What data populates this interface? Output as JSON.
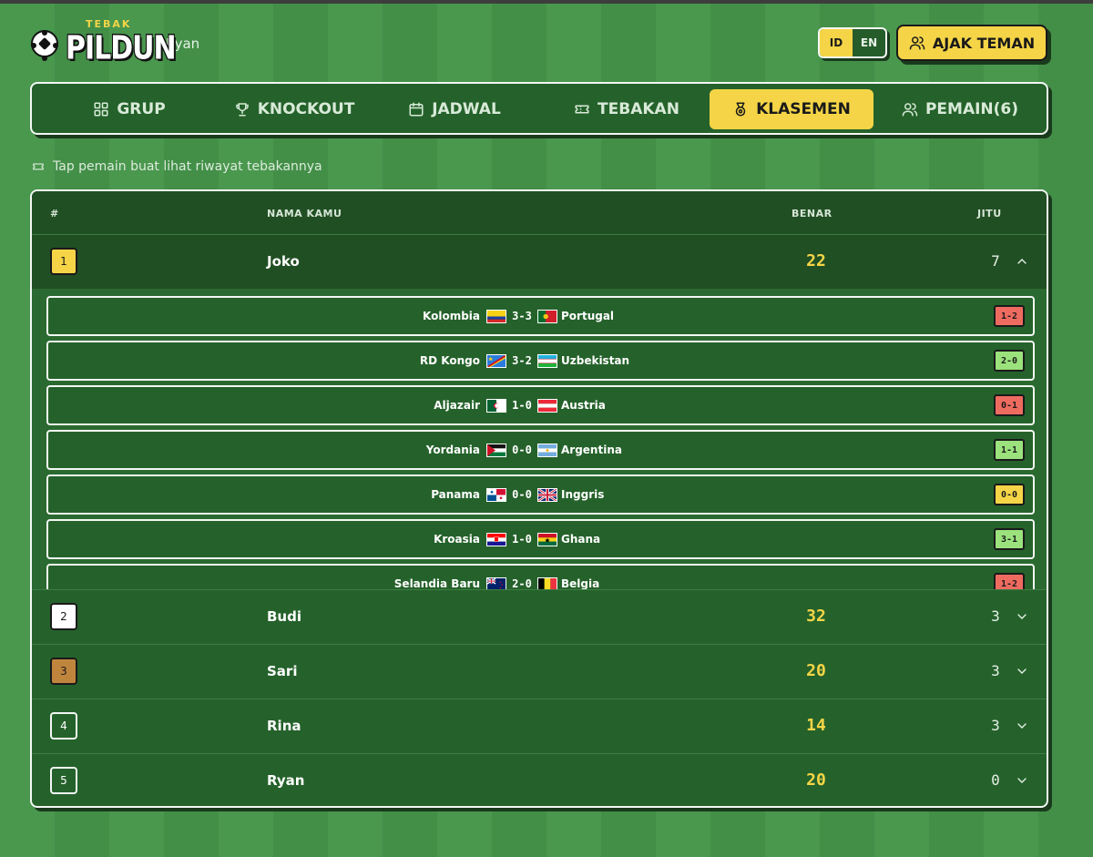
{
  "app": {
    "logo_small": "TEBAK",
    "logo_big": "PILDUN",
    "user": "Ryan"
  },
  "lang": {
    "id": "ID",
    "en": "EN",
    "active": "ID"
  },
  "invite_label": "AJAK TEMAN",
  "nav": [
    {
      "label": "GRUP",
      "icon": "grid-icon"
    },
    {
      "label": "KNOCKOUT",
      "icon": "trophy-icon"
    },
    {
      "label": "JADWAL",
      "icon": "calendar-icon"
    },
    {
      "label": "TEBAKAN",
      "icon": "ticket-icon"
    },
    {
      "label": "KLASEMEN",
      "icon": "medal-icon",
      "active": true
    },
    {
      "label": "PEMAIN(6)",
      "icon": "users-icon"
    }
  ],
  "hint": "Tap pemain buat lihat riwayat tebakannya",
  "table": {
    "headers": {
      "rank": "#",
      "name": "NAMA KAMU",
      "benar": "BENAR",
      "jitu": "JITU"
    },
    "rows": [
      {
        "rank": "1",
        "name": "Joko",
        "benar": "22",
        "jitu": "7",
        "expanded": true
      },
      {
        "rank": "2",
        "name": "Budi",
        "benar": "32",
        "jitu": "3"
      },
      {
        "rank": "3",
        "name": "Sari",
        "benar": "20",
        "jitu": "3"
      },
      {
        "rank": "4",
        "name": "Rina",
        "benar": "14",
        "jitu": "3"
      },
      {
        "rank": "5",
        "name": "Ryan",
        "benar": "20",
        "jitu": "0"
      }
    ]
  },
  "matches": [
    {
      "home": "Kolombia",
      "score": "3-3",
      "away": "Portugal",
      "pred": "1-2",
      "status": "wrong"
    },
    {
      "home": "RD Kongo",
      "score": "3-2",
      "away": "Uzbekistan",
      "pred": "2-0",
      "status": "right"
    },
    {
      "home": "Aljazair",
      "score": "1-0",
      "away": "Austria",
      "pred": "0-1",
      "status": "wrong"
    },
    {
      "home": "Yordania",
      "score": "0-0",
      "away": "Argentina",
      "pred": "1-1",
      "status": "right"
    },
    {
      "home": "Panama",
      "score": "0-0",
      "away": "Inggris",
      "pred": "0-0",
      "status": "exact"
    },
    {
      "home": "Kroasia",
      "score": "1-0",
      "away": "Ghana",
      "pred": "3-1",
      "status": "right"
    },
    {
      "home": "Selandia Baru",
      "score": "2-0",
      "away": "Belgia",
      "pred": "1-2",
      "status": "wrong"
    }
  ],
  "colors": {
    "accent": "#f5d547",
    "panel": "#25622b",
    "wrong": "#ee6b60",
    "right": "#9be27d"
  }
}
